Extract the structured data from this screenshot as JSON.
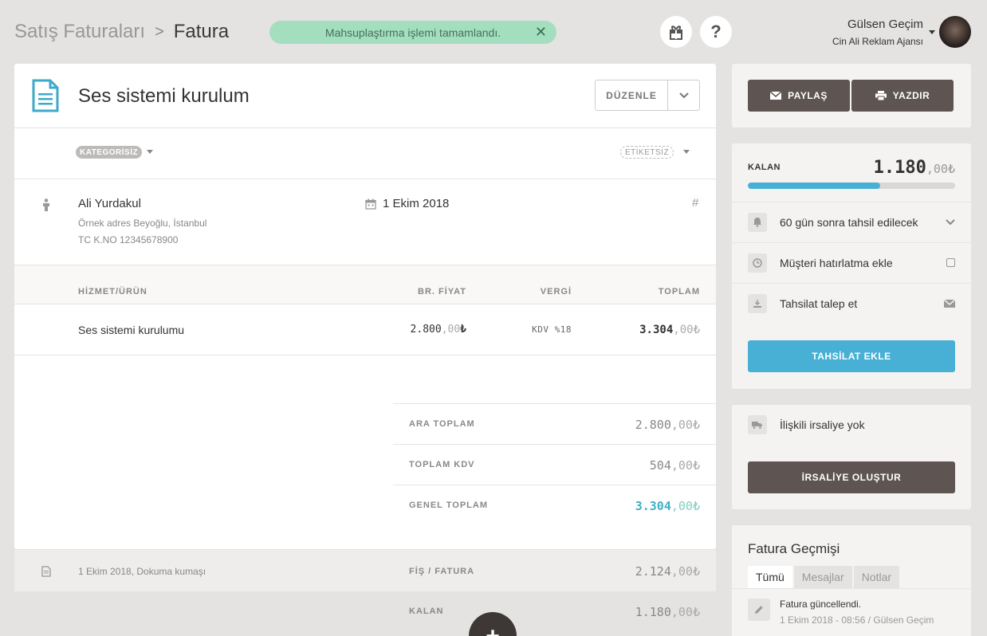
{
  "breadcrumb": {
    "parent": "Satış Faturaları",
    "separator": ">",
    "current": "Fatura"
  },
  "toast": {
    "message": "Mahsuplaştırma işlemi tamamlandı.",
    "close": "✕"
  },
  "header_icons": {
    "gift": "gift-icon",
    "help": "?"
  },
  "user": {
    "name": "Gülsen Geçim",
    "organization": "Cin Ali Reklam Ajansı"
  },
  "invoice": {
    "title": "Ses sistemi kurulum",
    "edit_label": "DÜZENLE",
    "category": "KATEGORİSİZ",
    "tags": "ETİKETSİZ",
    "customer": {
      "name": "Ali Yurdakul",
      "address": "Örnek adres Beyoğlu, İstanbul",
      "tax_id": "TC K.NO 12345678900"
    },
    "date": "1 Ekim 2018",
    "number_symbol": "#",
    "columns": {
      "item": "HİZMET/ÜRÜN",
      "unit_price": "BR. FİYAT",
      "tax": "VERGİ",
      "total": "TOPLAM"
    },
    "items": [
      {
        "name": "Ses sistemi kurulumu",
        "unit_price_int": "2.800",
        "unit_price_dec": ",00",
        "currency": "₺",
        "tax": "KDV %18",
        "total_int": "3.304",
        "total_dec": ",00₺"
      }
    ],
    "totals": [
      {
        "label": "ARA TOPLAM",
        "int": "2.800",
        "dec": ",00₺"
      },
      {
        "label": "TOPLAM KDV",
        "int": "504",
        "dec": ",00₺"
      },
      {
        "label": "GENEL TOPLAM",
        "int": "3.304",
        "dec": ",00₺"
      }
    ],
    "related": [
      {
        "description": "1 Ekim 2018, Dokuma kumaşı",
        "label": "FİŞ / FATURA",
        "int": "2.124",
        "dec": ",00₺"
      },
      {
        "label": "KALAN",
        "int": "1.180",
        "dec": ",00₺"
      }
    ],
    "fab": "+"
  },
  "actions": {
    "share": "PAYLAŞ",
    "print": "YAZDIR"
  },
  "payment": {
    "remaining_label": "KALAN",
    "remaining_int": "1.180",
    "remaining_dec": ",00₺",
    "progress_fraction": 0.64,
    "due": "60 gün sonra tahsil edilecek",
    "reminder": "Müşteri hatırlatma ekle",
    "request": "Tahsilat talep et",
    "add_payment": "TAHSİLAT EKLE",
    "accent_color": "#47b0d4"
  },
  "waybill": {
    "status": "İlişkili irsaliye yok",
    "create": "İRSALİYE OLUŞTUR"
  },
  "history": {
    "title": "Fatura Geçmişi",
    "tabs": [
      "Tümü",
      "Mesajlar",
      "Notlar"
    ],
    "entries": [
      {
        "text": "Fatura güncellendi.",
        "meta": "1 Ekim 2018 - 08:56 / Gülsen Geçim"
      }
    ]
  }
}
